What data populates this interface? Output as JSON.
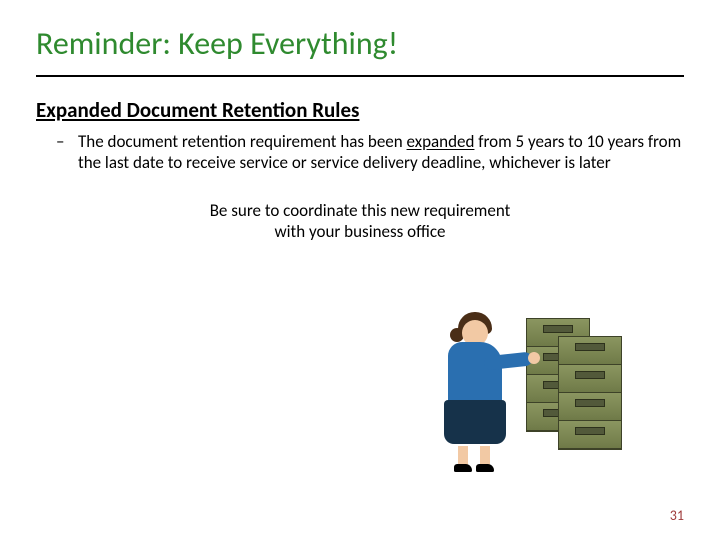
{
  "title": "Reminder: Keep Everything!",
  "subtitle": "Expanded Document Retention Rules",
  "bullet": {
    "pre": "The document retention requirement has been ",
    "emph": "expanded",
    "post": " from 5 years to 10 years from the last date to receive service or service delivery deadline, whichever is later"
  },
  "callout": {
    "line1": "Be sure to coordinate this new requirement",
    "line2": "with your business office"
  },
  "clipart": {
    "desc": "person-at-filing-cabinets-icon"
  },
  "page_number": "31"
}
